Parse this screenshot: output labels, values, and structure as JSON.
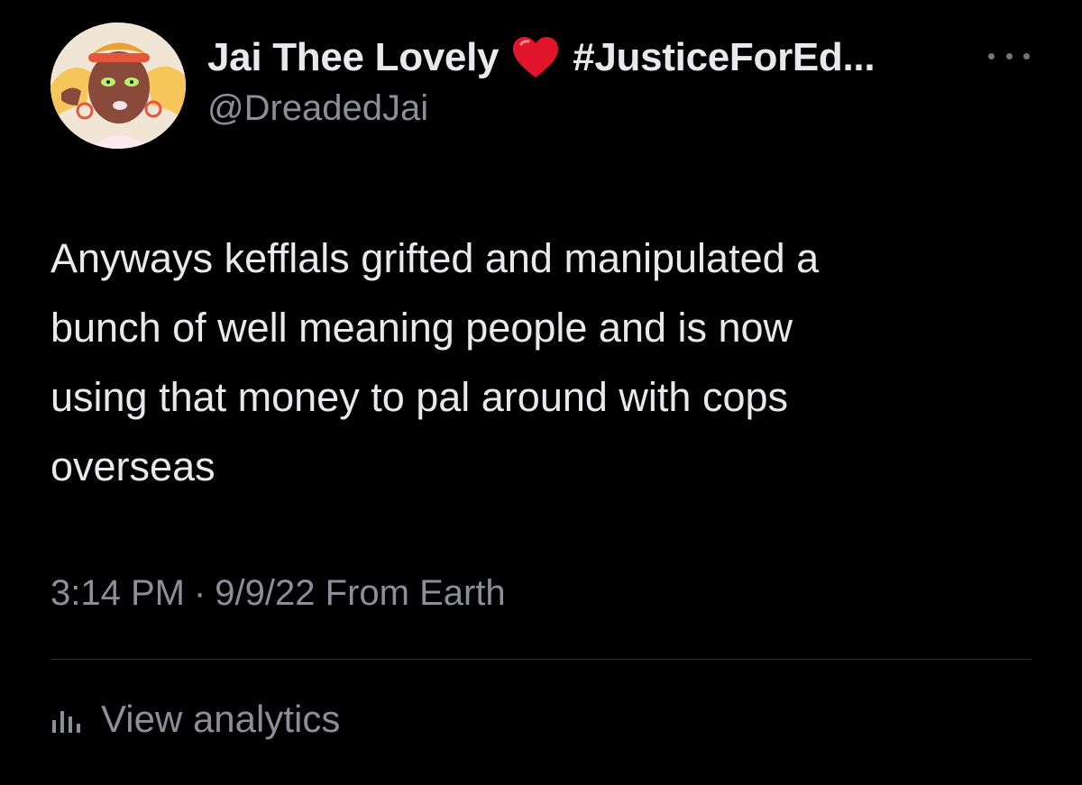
{
  "tweet": {
    "author": {
      "display_name": "Jai Thee Lovely",
      "name_emoji": "heart-emoji",
      "name_tag": "#JusticeForEd...",
      "handle": "@DreadedJai"
    },
    "menu_icon": "more-horizontal-icon",
    "text_lines": [
      "Anyways kefflals grifted and manipulated a",
      "bunch of well meaning people and is now",
      "using that money to pal around with cops",
      "overseas"
    ],
    "meta": {
      "time": "3:14 PM",
      "separator": "·",
      "date": "9/9/22",
      "source": "From Earth"
    },
    "analytics": {
      "icon": "bar-chart-icon",
      "label": "View analytics"
    }
  },
  "colors": {
    "background": "#000000",
    "primary_text": "#e7e9ea",
    "secondary_text": "#8b9096",
    "divider": "#2f3336",
    "heart": "#e0152b"
  }
}
